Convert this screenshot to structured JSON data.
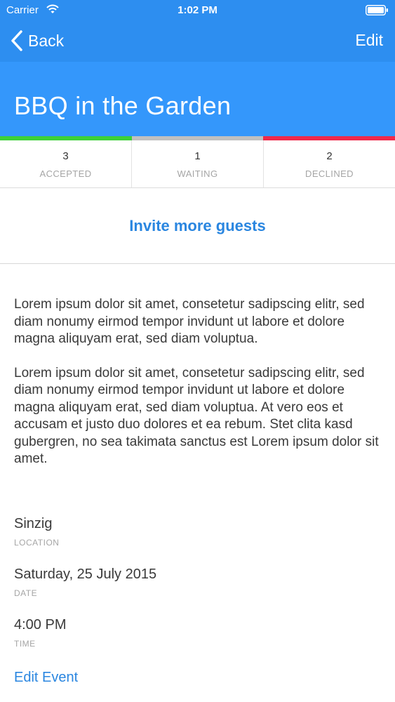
{
  "status_bar": {
    "carrier": "Carrier",
    "time": "1:02 PM"
  },
  "nav": {
    "back_label": "Back",
    "edit_label": "Edit"
  },
  "event": {
    "title": "BBQ in the Garden"
  },
  "rsvp": {
    "colors": [
      "#3dd137",
      "#c0c0c0",
      "#f0294a"
    ],
    "stats": [
      {
        "count": "3",
        "label": "ACCEPTED"
      },
      {
        "count": "1",
        "label": "WAITING"
      },
      {
        "count": "2",
        "label": "DECLINED"
      }
    ]
  },
  "invite_label": "Invite more guests",
  "description": [
    "Lorem ipsum dolor sit amet, consetetur sadipscing elitr, sed diam nonumy eirmod tempor invidunt ut labore et dolore magna aliquyam erat, sed diam voluptua.",
    "Lorem ipsum dolor sit amet, consetetur sadipscing elitr, sed diam nonumy eirmod tempor invidunt ut labore et dolore magna aliquyam erat, sed diam voluptua. At vero eos et accusam et justo duo dolores et ea rebum. Stet clita kasd gubergren, no sea takimata sanctus est Lorem ipsum dolor sit amet."
  ],
  "details": {
    "location": {
      "value": "Sinzig",
      "label": "LOCATION"
    },
    "date": {
      "value": "Saturday, 25 July 2015",
      "label": "DATE"
    },
    "time": {
      "value": "4:00 PM",
      "label": "TIME"
    }
  },
  "edit_event_label": "Edit Event",
  "icons": {
    "wifi": "wifi-icon",
    "battery": "battery-icon",
    "back": "chevron-left-icon"
  },
  "theme": {
    "nav_blue": "#2d8ef0",
    "header_blue": "#3497fb",
    "link_blue": "#2a86e0"
  }
}
